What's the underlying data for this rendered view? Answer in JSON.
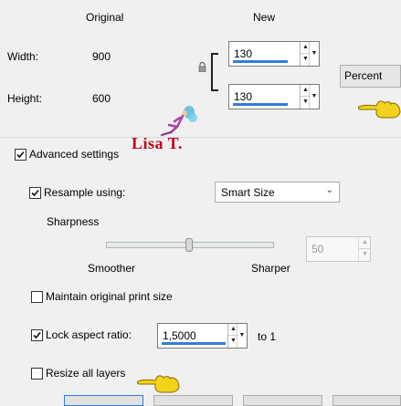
{
  "columns": {
    "original": "Original",
    "new": "New"
  },
  "width": {
    "label": "Width:",
    "original": "900",
    "new_value": "130"
  },
  "height": {
    "label": "Height:",
    "original": "600",
    "new_value": "130"
  },
  "unit": {
    "selected": "Percent"
  },
  "watermark": {
    "text": "Lisa T."
  },
  "advanced": {
    "label": "Advanced settings",
    "checked": true
  },
  "resample": {
    "label": "Resample using:",
    "checked": true,
    "method": "Smart Size"
  },
  "sharpness": {
    "label": "Sharpness",
    "min_label": "Smoother",
    "max_label": "Sharper",
    "value": "50",
    "level": 0.5
  },
  "maintain_print": {
    "label": "Maintain original print size",
    "checked": false
  },
  "lock_aspect": {
    "label": "Lock aspect ratio:",
    "checked": true,
    "value": "1,5000",
    "suffix": "to 1"
  },
  "resize_layers": {
    "label": "Resize all layers",
    "checked": false
  },
  "icons": {
    "lock": "lock-icon",
    "pointer": "pointing-hand-icon",
    "fairy": "fairy-icon"
  },
  "colors": {
    "accent": "#2f7fd6",
    "pointer": "#f2d21c",
    "watermark": "#c0001a"
  }
}
